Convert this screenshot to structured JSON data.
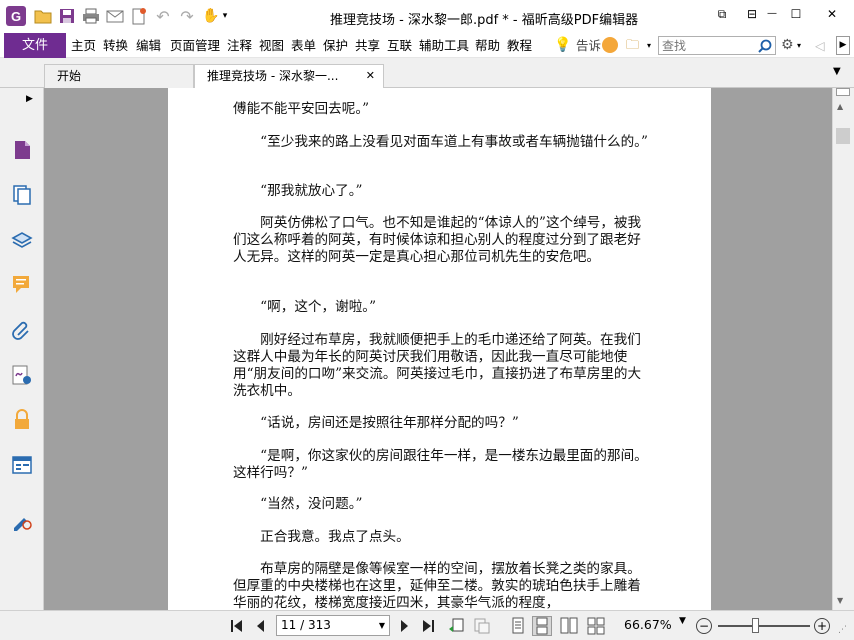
{
  "window": {
    "title": "推理竞技场 - 深水黎一郎.pdf * - 福昕高级PDF编辑器",
    "logo_letter": "G",
    "controls": {
      "restore": "⧉",
      "ribbon": "⊟",
      "minimize": "—",
      "maximize": "☐",
      "close": "✕"
    }
  },
  "menubar": {
    "file": "文件",
    "items": [
      "主页",
      "转换",
      "编辑",
      "页面管理",
      "注释",
      "视图",
      "表单",
      "保护",
      "共享",
      "互联",
      "辅助工具",
      "帮助",
      "教程"
    ],
    "tell_me": "告诉",
    "search_placeholder": "查找"
  },
  "tabs": [
    {
      "label": "开始"
    },
    {
      "label": "推理竞技场 - 深水黎一...",
      "close": "✕"
    }
  ],
  "document": {
    "paragraphs": [
      "傅能不能平安回去呢。”",
      "　　“至少我来的路上没看见对面车道上有事故或者车辆抛锚什么的。”",
      "　　“那我就放心了。”",
      "　　阿英仿佛松了口气。也不知是谁起的“体谅人的”这个绰号，被我们这么称呼着的阿英，有时候体谅和担心别人的程度过分到了跟老好人无异。这样的阿英一定是真心担心那位司机先生的安危吧。",
      "　　“啊，这个，谢啦。”",
      "　　刚好经过布草房，我就顺便把手上的毛巾递还给了阿英。在我们这群人中最为年长的阿英讨厌我们用敬语，因此我一直尽可能地使用“朋友间的口吻”来交流。阿英接过毛巾，直接扔进了布草房里的大洗衣机中。",
      "　　“话说，房间还是按照往年那样分配的吗？”",
      "　　“是啊，你这家伙的房间跟往年一样，是一楼东边最里面的那间。这样行吗？”",
      "　　“当然，没问题。”",
      "　　正合我意。我点了点头。",
      "　　布草房的隔壁是像等候室一样的空间，摆放着长凳之类的家具。但厚重的中央楼梯也在这里，延伸至二楼。敦实的琥珀色扶手上雕着华丽的花纹，楼梯宽度接近四米，其豪华气派的程度，"
    ]
  },
  "status": {
    "page_indicator": "11 / 313",
    "zoom": "66.67%",
    "zoom_fraction": 0.4
  }
}
